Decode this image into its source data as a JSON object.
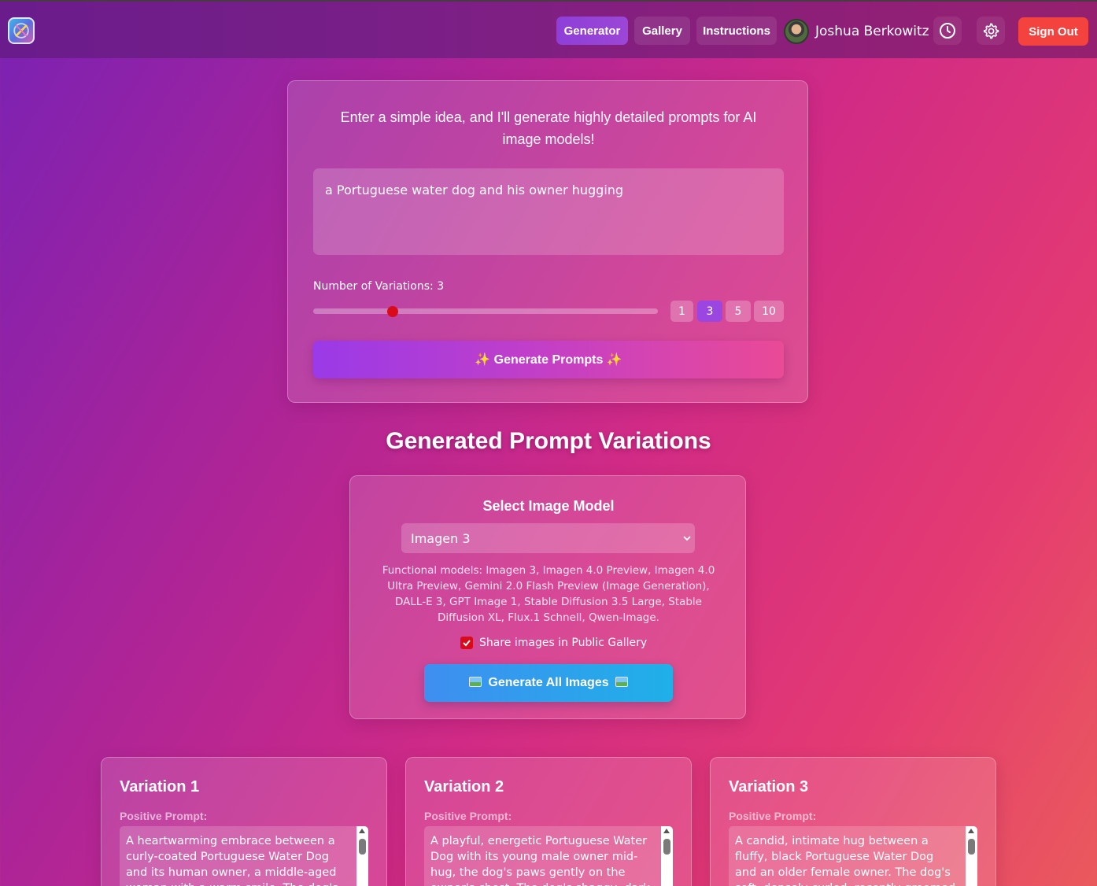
{
  "nav": {
    "generator": "Generator",
    "gallery": "Gallery",
    "instructions": "Instructions",
    "user_name": "Joshua Berkowitz",
    "sign_out": "Sign Out"
  },
  "generator": {
    "intro": "Enter a simple idea, and I'll generate highly detailed prompts for AI image models!",
    "idea_value": "a Portuguese water dog and his owner hugging",
    "variations_label": "Number of Variations: 3",
    "variations_value": 3,
    "presets": [
      "1",
      "3",
      "5",
      "10"
    ],
    "generate_button": "✨ Generate Prompts ✨"
  },
  "results": {
    "title": "Generated Prompt Variations",
    "model_title": "Select Image Model",
    "model_selected": "Imagen 3",
    "functional_models": "Functional models: Imagen 3, Imagen 4.0 Preview, Imagen 4.0 Ultra Preview, Gemini 2.0 Flash Preview (Image Generation), DALL-E 3, GPT Image 1, Stable Diffusion 3.5 Large, Stable Diffusion XL, Flux.1 Schnell, Qwen-Image.",
    "share_label": "Share images in Public Gallery",
    "share_checked": true,
    "generate_all": "Generate All Images"
  },
  "variations": [
    {
      "title": "Variation 1",
      "label": "Positive Prompt:",
      "text": "A heartwarming embrace between a curly-coated Portuguese Water Dog and its human owner, a middle-aged woman with a warm smile. The dog's thick, wavy"
    },
    {
      "title": "Variation 2",
      "label": "Positive Prompt:",
      "text": "A playful, energetic Portuguese Water Dog with its young male owner mid-hug, the dog's paws gently on the owner's chest. The dog's shaggy, dark brown curly coat"
    },
    {
      "title": "Variation 3",
      "label": "Positive Prompt:",
      "text": "A candid, intimate hug between a fluffy, black Portuguese Water Dog and an older female owner. The dog's soft, densely curled, recently groomed black fur, a"
    }
  ],
  "colors": {
    "accent_purple": "#9b46e0",
    "sign_out_red": "#f4423e",
    "slider_thumb": "#d90b1a",
    "images_button": "#1fb0e8"
  },
  "icons": {
    "history": "clock-icon",
    "settings": "gear-icon",
    "logo": "app-logo-icon"
  }
}
